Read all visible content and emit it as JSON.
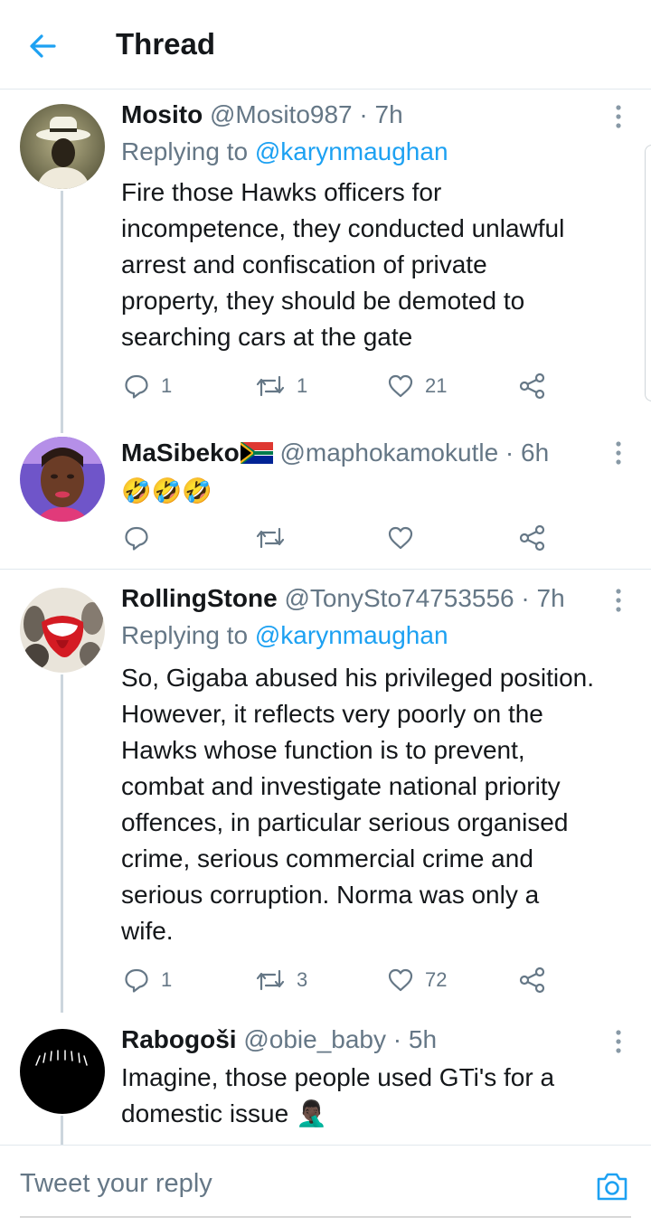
{
  "header": {
    "title": "Thread",
    "back_icon": "arrow-left-icon",
    "accent": "#1da1f2"
  },
  "tweets": [
    {
      "name": "Mosito",
      "handle": "@Mosito987",
      "time": "· 7h",
      "replying_prefix": "Replying to",
      "replying_handle": "@karynmaughan",
      "body_lines": [
        "Fire those Hawks officers for",
        "incompetence, they conducted unlawful",
        "arrest and confiscation of private",
        "property, they should be demoted to",
        "searching cars at the gate"
      ],
      "replies": "1",
      "retweets": "1",
      "likes": "21"
    },
    {
      "name": "MaSibeko",
      "name_flag": "south-africa-flag",
      "handle": "@maphokamokutle",
      "time": "· 6h",
      "body_emoji": "🤣🤣🤣",
      "replies": "",
      "retweets": "",
      "likes": ""
    },
    {
      "name": "RollingStone",
      "handle": "@TonySto74753556",
      "time": "· 7h",
      "replying_prefix": "Replying to",
      "replying_handle": "@karynmaughan",
      "body_lines": [
        "So, Gigaba abused his privileged position.",
        "However, it reflects very poorly on the",
        "Hawks whose function is to prevent,",
        "combat and investigate national priority",
        "offences, in particular serious organised",
        "crime, serious commercial crime and",
        "serious corruption. Norma was only a",
        "wife."
      ],
      "replies": "1",
      "retweets": "3",
      "likes": "72"
    },
    {
      "name": "Rabogoši",
      "handle": "@obie_baby",
      "time": "· 5h",
      "body_lines": [
        "Imagine, those people used GTi's for a",
        "domestic issue 🤦🏿‍♂️"
      ]
    }
  ],
  "reply_bar": {
    "placeholder": "Tweet your reply",
    "camera_icon": "camera-icon"
  }
}
